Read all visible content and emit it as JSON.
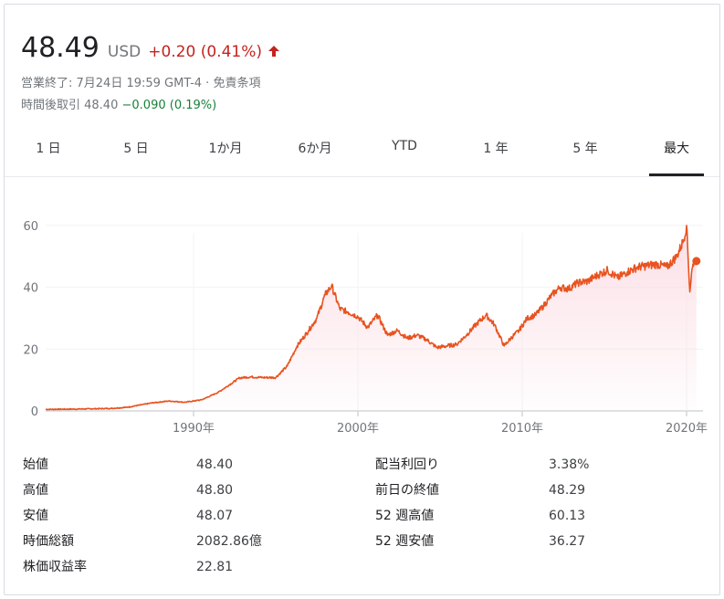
{
  "quote": {
    "price": "48.49",
    "currency": "USD",
    "change": "+0.20 (0.41%)",
    "change_direction_icon": "arrow-up-icon",
    "close_info": "営業終了: 7月24日 19:59 GMT-4 · 免責条項",
    "after_hours_label": "時間後取引 48.40",
    "after_hours_change": "−0.090 (0.19%)"
  },
  "colors": {
    "up": "#c5221f",
    "down": "#188038",
    "line": "#e8531f",
    "fill": "#fbdde4"
  },
  "tabs": [
    {
      "label": "1 日"
    },
    {
      "label": "5 日"
    },
    {
      "label": "1か月"
    },
    {
      "label": "6か月"
    },
    {
      "label": "YTD"
    },
    {
      "label": "1 年"
    },
    {
      "label": "5 年"
    },
    {
      "label": "最大",
      "active": true
    }
  ],
  "chart_data": {
    "type": "area",
    "title": "",
    "xlabel": "",
    "ylabel": "",
    "xlim": [
      1981,
      2021
    ],
    "ylim": [
      0,
      65
    ],
    "yticks": [
      "0",
      "20",
      "40",
      "60"
    ],
    "xticks": [
      "1990年",
      "2000年",
      "2010年",
      "2020年"
    ],
    "grid": true,
    "series": [
      {
        "x": [
          1981.0,
          1983.0,
          1985.0,
          1986.0,
          1987.5,
          1988.5,
          1989.5,
          1990.5,
          1991.5,
          1992.2,
          1992.8,
          1993.5,
          1994.2,
          1995.0,
          1995.7,
          1996.3,
          1997.0,
          1997.5,
          1998.0,
          1998.4,
          1998.9,
          1999.4,
          2000.0,
          2000.6,
          2001.2,
          2001.8,
          2002.4,
          2003.0,
          2003.6,
          2004.2,
          2004.8,
          2005.4,
          2006.0,
          2006.6,
          2007.2,
          2007.8,
          2008.3,
          2008.9,
          2009.3,
          2009.8,
          2010.3,
          2010.8,
          2011.3,
          2011.8,
          2012.3,
          2012.8,
          2013.4,
          2014.0,
          2014.6,
          2015.2,
          2015.8,
          2016.4,
          2017.0,
          2017.6,
          2018.2,
          2018.8,
          2019.4,
          2019.8,
          2020.0,
          2020.2,
          2020.3,
          2020.45,
          2020.6
        ],
        "y": [
          0.5,
          0.6,
          0.8,
          1.2,
          2.6,
          3.2,
          2.8,
          3.6,
          6.0,
          8.5,
          10.7,
          11.0,
          10.8,
          10.8,
          14.5,
          21.0,
          26.0,
          30.0,
          37.5,
          40.5,
          33.0,
          32.0,
          30.5,
          27.0,
          31.0,
          24.5,
          26.0,
          23.5,
          24.5,
          23.0,
          20.5,
          21.0,
          21.5,
          24.5,
          28.0,
          31.0,
          28.0,
          21.0,
          23.5,
          26.0,
          30.0,
          31.0,
          34.0,
          37.5,
          40.0,
          39.5,
          41.5,
          42.0,
          44.0,
          45.5,
          43.0,
          45.0,
          46.5,
          47.0,
          47.5,
          46.5,
          50.0,
          55.0,
          60.0,
          38.5,
          44.5,
          48.8,
          48.49
        ]
      }
    ]
  },
  "stats": {
    "left": [
      {
        "label": "始値",
        "value": "48.40"
      },
      {
        "label": "高値",
        "value": "48.80"
      },
      {
        "label": "安値",
        "value": "48.07"
      },
      {
        "label": "時価総額",
        "value": "2082.86億"
      },
      {
        "label": "株価収益率",
        "value": "22.81"
      }
    ],
    "right": [
      {
        "label": "配当利回り",
        "value": "3.38%"
      },
      {
        "label": "前日の終値",
        "value": "48.29"
      },
      {
        "label": "52 週高値",
        "value": "60.13"
      },
      {
        "label": "52 週安値",
        "value": "36.27"
      }
    ]
  }
}
